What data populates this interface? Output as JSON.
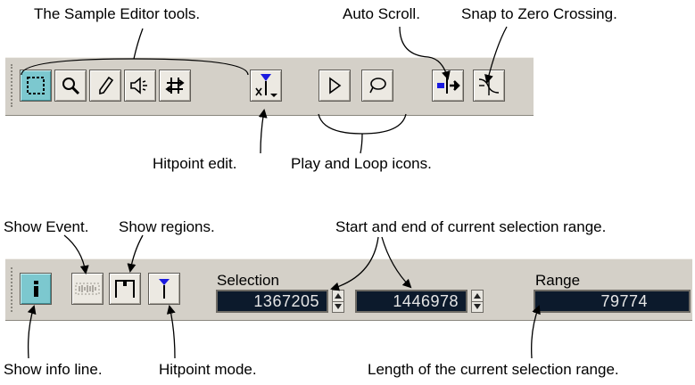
{
  "callouts": {
    "sample_editor_tools": "The Sample Editor tools.",
    "auto_scroll": "Auto Scroll.",
    "snap_zero": "Snap to Zero Crossing.",
    "hitpoint_edit": "Hitpoint edit.",
    "play_loop": "Play and Loop icons.",
    "show_event": "Show Event.",
    "show_regions": "Show regions.",
    "start_end": "Start and end of current selection range.",
    "show_info": "Show info line.",
    "hitpoint_mode": "Hitpoint mode.",
    "length_range": "Length of the current selection range."
  },
  "toolbar_top": {
    "tools": [
      {
        "name": "range-select-icon",
        "active": true
      },
      {
        "name": "magnifier-icon",
        "active": false
      },
      {
        "name": "pencil-icon",
        "active": false
      },
      {
        "name": "speaker-icon",
        "active": false
      },
      {
        "name": "scrub-icon",
        "active": false
      },
      {
        "name": "hitpoint-edit-icon",
        "active": false
      }
    ],
    "play_icon": "play-icon",
    "loop_icon": "loop-icon",
    "auto_scroll_icon": "auto-scroll-icon",
    "snap_zero_icon": "snap-zero-crossing-icon"
  },
  "toolbar_bottom": {
    "info_icon": "info-icon",
    "show_event_icon": "show-event-icon",
    "show_regions_icon": "show-regions-icon",
    "hitpoint_mode_icon": "hitpoint-mode-icon",
    "selection_label": "Selection",
    "selection_start": "1367205",
    "selection_end": "1446978",
    "range_label": "Range",
    "range_value": "79774"
  },
  "colors": {
    "toolbar_bg": "#d4d0c8",
    "active_button": "#7cc8cf",
    "field_bg": "#0c1a2c",
    "field_text": "#e6e6e6",
    "hitpoint_blue": "#1a1ae0"
  }
}
